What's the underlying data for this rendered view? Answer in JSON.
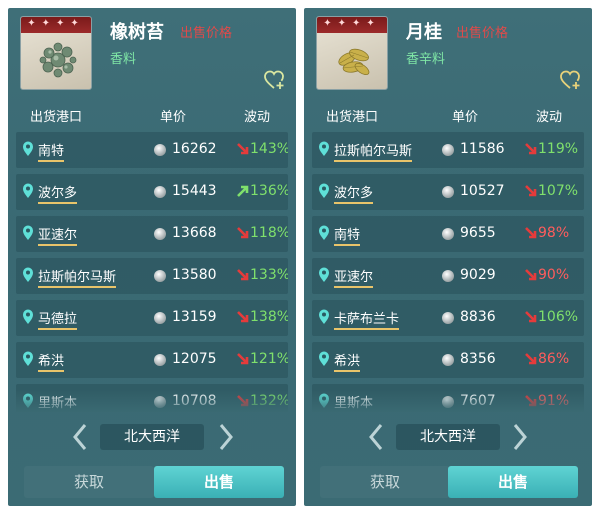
{
  "columns": {
    "port": "出货港口",
    "unit_price": "单价",
    "change": "波动"
  },
  "colors": {
    "up": "#7fe06c",
    "down": "#e53b3b",
    "pct_up": "#7fe06c",
    "pct_down_red": "#ff5c5c",
    "pct_green": "#7fe06c"
  },
  "icons": {
    "pin": "location-pin-icon",
    "coin": "silver-coin-icon",
    "heart": "heart-plus-icon",
    "prev": "chevron-left-icon",
    "next": "chevron-right-icon"
  },
  "panels": [
    {
      "stars": "✦✦✦✦",
      "title": "橡树苔",
      "price_label": "出售价格",
      "category": "香料",
      "region": "北大西洋",
      "tabs": {
        "get": "获取",
        "sell": "出售"
      },
      "rows": [
        {
          "port": "南特",
          "price": "16262",
          "dir": "down",
          "pct": "143%",
          "pct_color": "green"
        },
        {
          "port": "波尔多",
          "price": "15443",
          "dir": "up",
          "pct": "136%",
          "pct_color": "green"
        },
        {
          "port": "亚速尔",
          "price": "13668",
          "dir": "down",
          "pct": "118%",
          "pct_color": "green"
        },
        {
          "port": "拉斯帕尔马斯",
          "price": "13580",
          "dir": "down",
          "pct": "133%",
          "pct_color": "green"
        },
        {
          "port": "马德拉",
          "price": "13159",
          "dir": "down",
          "pct": "138%",
          "pct_color": "green"
        },
        {
          "port": "希洪",
          "price": "12075",
          "dir": "down",
          "pct": "121%",
          "pct_color": "green"
        },
        {
          "port": "里斯本",
          "price": "10708",
          "dir": "down",
          "pct": "132%",
          "pct_color": "green"
        }
      ]
    },
    {
      "stars": "✦✦✦✦",
      "title": "月桂",
      "price_label": "出售价格",
      "category": "香辛料",
      "region": "北大西洋",
      "tabs": {
        "get": "获取",
        "sell": "出售"
      },
      "rows": [
        {
          "port": "拉斯帕尔马斯",
          "price": "11586",
          "dir": "down",
          "pct": "119%",
          "pct_color": "green"
        },
        {
          "port": "波尔多",
          "price": "10527",
          "dir": "down",
          "pct": "107%",
          "pct_color": "green"
        },
        {
          "port": "南特",
          "price": "9655",
          "dir": "down",
          "pct": "98%",
          "pct_color": "red"
        },
        {
          "port": "亚速尔",
          "price": "9029",
          "dir": "down",
          "pct": "90%",
          "pct_color": "red"
        },
        {
          "port": "卡萨布兰卡",
          "price": "8836",
          "dir": "down",
          "pct": "106%",
          "pct_color": "green"
        },
        {
          "port": "希洪",
          "price": "8356",
          "dir": "down",
          "pct": "86%",
          "pct_color": "red"
        },
        {
          "port": "里斯本",
          "price": "7607",
          "dir": "down",
          "pct": "91%",
          "pct_color": "red"
        }
      ]
    }
  ]
}
